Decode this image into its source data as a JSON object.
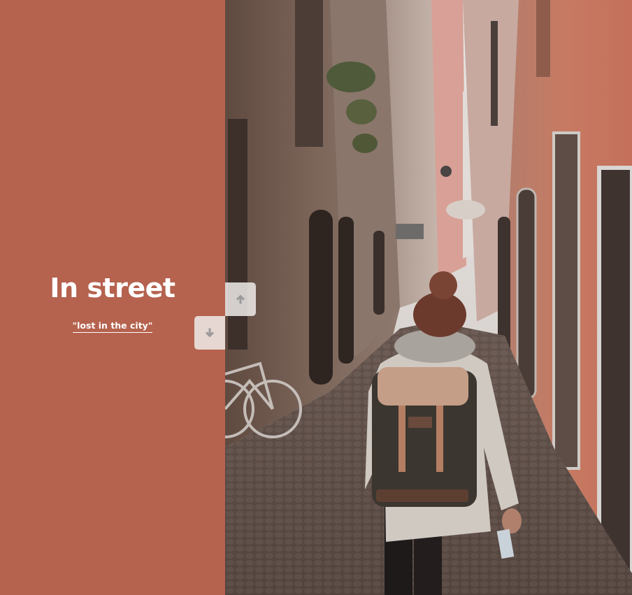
{
  "slide": {
    "title": "In street",
    "subtitle": "\"lost in the city\""
  },
  "navigation": {
    "up_icon": "arrow-up-icon",
    "down_icon": "arrow-down-icon"
  },
  "colors": {
    "panel_background": "#b5624e",
    "text": "#ffffff",
    "button_background": "#eeeae8",
    "button_icon": "#9a9a9a"
  }
}
